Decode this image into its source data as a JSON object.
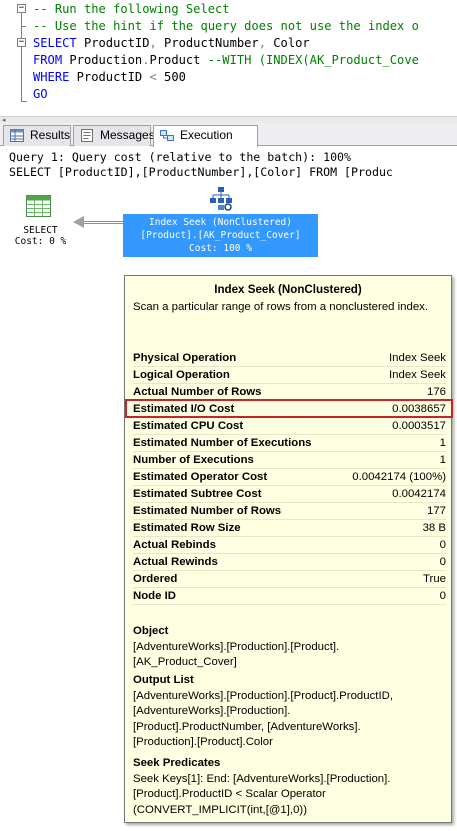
{
  "editor": {
    "lines": [
      {
        "parts": [
          {
            "t": "-- Run the following Select",
            "c": "comment"
          }
        ]
      },
      {
        "parts": [
          {
            "t": "-- Use the hint if the query does not use the index o",
            "c": "comment"
          }
        ]
      },
      {
        "parts": [
          {
            "t": "SELECT",
            "c": "kw"
          },
          {
            "t": " ProductID",
            "c": "plain"
          },
          {
            "t": ",",
            "c": "op"
          },
          {
            "t": " ProductNumber",
            "c": "plain"
          },
          {
            "t": ",",
            "c": "op"
          },
          {
            "t": " Color",
            "c": "plain"
          }
        ]
      },
      {
        "parts": [
          {
            "t": "FROM",
            "c": "kw"
          },
          {
            "t": " Production",
            "c": "plain"
          },
          {
            "t": ".",
            "c": "op"
          },
          {
            "t": "Product ",
            "c": "plain"
          },
          {
            "t": "--WITH (INDEX(AK_Product_Cove",
            "c": "comment"
          }
        ]
      },
      {
        "parts": [
          {
            "t": "WHERE",
            "c": "kw"
          },
          {
            "t": " ProductID ",
            "c": "plain"
          },
          {
            "t": "<",
            "c": "op"
          },
          {
            "t": " 500",
            "c": "plain"
          }
        ]
      },
      {
        "parts": [
          {
            "t": "GO",
            "c": "kw"
          }
        ]
      }
    ],
    "fold_minus": "−"
  },
  "tabs": [
    {
      "label": "Results",
      "icon": "grid-icon"
    },
    {
      "label": "Messages",
      "icon": "messages-icon"
    },
    {
      "label": "Execution plan",
      "icon": "execution-plan-icon"
    }
  ],
  "query_header": {
    "line1": "Query 1: Query cost (relative to the batch): 100%",
    "line2": "SELECT [ProductID],[ProductNumber],[Color] FROM [Produc"
  },
  "plan": {
    "select_node": {
      "name": "SELECT",
      "cost": "Cost: 0 %"
    },
    "seek_node": {
      "line1": "Index Seek (NonClustered)",
      "line2": "[Product].[AK_Product_Cover]",
      "line3": "Cost: 100 %",
      "highlight_color": "#3399ff"
    }
  },
  "tooltip": {
    "title": "Index Seek (NonClustered)",
    "description": "Scan a particular range of rows from a nonclustered index.",
    "rows": [
      {
        "key": "Physical Operation",
        "value": "Index Seek"
      },
      {
        "key": "Logical Operation",
        "value": "Index Seek"
      },
      {
        "key": "Actual Number of Rows",
        "value": "176"
      },
      {
        "key": "Estimated I/O Cost",
        "value": "0.0038657"
      },
      {
        "key": "Estimated CPU Cost",
        "value": "0.0003517"
      },
      {
        "key": "Estimated Number of Executions",
        "value": "1"
      },
      {
        "key": "Number of Executions",
        "value": "1"
      },
      {
        "key": "Estimated Operator Cost",
        "value": "0.0042174 (100%)"
      },
      {
        "key": "Estimated Subtree Cost",
        "value": "0.0042174"
      },
      {
        "key": "Estimated Number of Rows",
        "value": "177"
      },
      {
        "key": "Estimated Row Size",
        "value": "38 B"
      },
      {
        "key": "Actual Rebinds",
        "value": "0"
      },
      {
        "key": "Actual Rewinds",
        "value": "0"
      },
      {
        "key": "Ordered",
        "value": "True"
      },
      {
        "key": "Node ID",
        "value": "0"
      }
    ],
    "highlighted_row": "Estimated I/O Cost",
    "highlight_color": "#c0262c",
    "object": {
      "heading": "Object",
      "lines": [
        "[AdventureWorks].[Production].[Product].",
        "[AK_Product_Cover]"
      ]
    },
    "output_list": {
      "heading": "Output List",
      "lines": [
        "[AdventureWorks].[Production].[Product].ProductID,",
        "[AdventureWorks].[Production].",
        "[Product].ProductNumber, [AdventureWorks].",
        "[Production].[Product].Color"
      ]
    },
    "seek_predicates": {
      "heading": "Seek Predicates",
      "lines": [
        "Seek Keys[1]: End: [AdventureWorks].[Production].",
        "[Product].ProductID < Scalar Operator",
        "(CONVERT_IMPLICIT(int,[@1],0))"
      ]
    }
  }
}
